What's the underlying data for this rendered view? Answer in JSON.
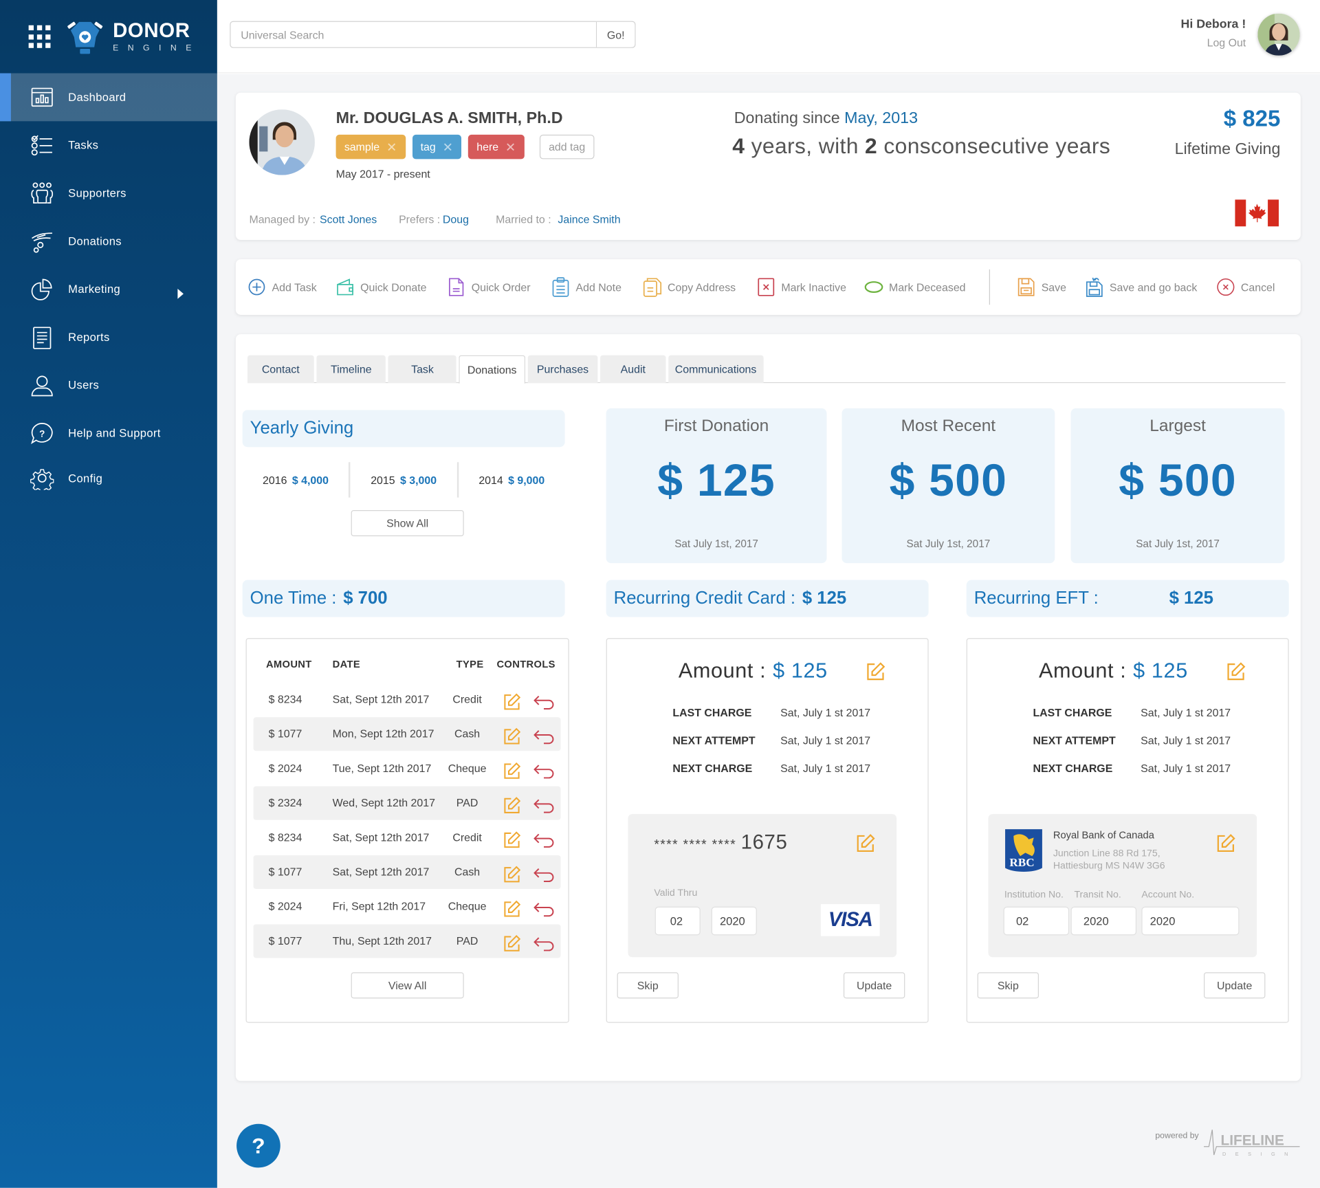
{
  "app": {
    "brand_name": "DONOR",
    "brand_sub": "ENGINE"
  },
  "colors": {
    "accent": "#1a74b8",
    "sidebar_top": "#063a64",
    "tag_sample": "#e8ae4b",
    "tag_tag": "#4f9fd0",
    "tag_here": "#d65a5a",
    "edit_icon": "#f0a830",
    "undo_icon": "#c8424f"
  },
  "sidebar": {
    "items": [
      {
        "label": "Dashboard",
        "icon": "dashboard-icon",
        "active": true
      },
      {
        "label": "Tasks",
        "icon": "tasks-icon"
      },
      {
        "label": "Supporters",
        "icon": "supporters-icon"
      },
      {
        "label": "Donations",
        "icon": "donations-icon"
      },
      {
        "label": "Marketing",
        "icon": "pie-chart-icon",
        "has_submenu": true
      },
      {
        "label": "Reports",
        "icon": "reports-icon"
      },
      {
        "label": "Users",
        "icon": "user-icon"
      },
      {
        "label": "Help and Support",
        "icon": "help-icon"
      },
      {
        "label": "Config",
        "icon": "gear-icon"
      }
    ]
  },
  "topbar": {
    "search_placeholder": "Universal Search",
    "search_value": "",
    "go_label": "Go!",
    "greeting": "Hi Debora !",
    "logout_label": "Log Out"
  },
  "profile": {
    "name": "Mr. DOUGLAS A. SMITH, Ph.D",
    "tags": [
      "sample",
      "tag",
      "here"
    ],
    "add_tag_label": "add tag",
    "period": "May 2017 - present",
    "managed_by_label": "Managed by :",
    "managed_by": "Scott Jones",
    "prefers_label": "Prefers :",
    "prefers": "Doug",
    "married_label": "Married to :",
    "married_to": "Jaince Smith",
    "donating_since_label": "Donating since",
    "donating_since": "May, 2013",
    "years_total": "4",
    "years_text_1": "years, with",
    "years_consecutive": "2",
    "years_text_2": "consconsecutive years",
    "lifetime_amount": "$ 825",
    "lifetime_label": "Lifetime Giving",
    "country_flag": "canada-flag"
  },
  "actions": {
    "add_task": "Add Task",
    "quick_donate": "Quick Donate",
    "quick_order": "Quick Order",
    "add_note": "Add Note",
    "copy_address": "Copy Address",
    "mark_inactive": "Mark Inactive",
    "mark_deceased": "Mark Deceased",
    "save": "Save",
    "save_back": "Save and go back",
    "cancel": "Cancel"
  },
  "tabs": [
    {
      "label": "Contact"
    },
    {
      "label": "Timeline"
    },
    {
      "label": "Task"
    },
    {
      "label": "Donations",
      "active": true
    },
    {
      "label": "Purchases"
    },
    {
      "label": "Audit"
    },
    {
      "label": "Communications"
    }
  ],
  "yearly": {
    "title": "Yearly Giving",
    "years": [
      {
        "year": "2016",
        "amount": "$ 4,000"
      },
      {
        "year": "2015",
        "amount": "$ 3,000"
      },
      {
        "year": "2014",
        "amount": "$ 9,000"
      }
    ],
    "show_all_label": "Show All"
  },
  "stats": [
    {
      "title": "First Donation",
      "amount": "$ 125",
      "date": "Sat July 1st, 2017"
    },
    {
      "title": "Most Recent",
      "amount": "$ 500",
      "date": "Sat July 1st, 2017"
    },
    {
      "title": "Largest",
      "amount": "$ 500",
      "date": "Sat July 1st, 2017"
    }
  ],
  "one_time": {
    "label": "One Time :",
    "amount": "$ 700",
    "columns": [
      "AMOUNT",
      "DATE",
      "TYPE",
      "CONTROLS"
    ],
    "rows": [
      {
        "amount": "$ 8234",
        "date": "Sat, Sept 12th 2017",
        "type": "Credit"
      },
      {
        "amount": "$ 1077",
        "date": "Mon, Sept 12th 2017",
        "type": "Cash"
      },
      {
        "amount": "$ 2024",
        "date": "Tue, Sept 12th 2017",
        "type": "Cheque"
      },
      {
        "amount": "$ 2324",
        "date": "Wed, Sept 12th 2017",
        "type": "PAD"
      },
      {
        "amount": "$ 8234",
        "date": "Sat, Sept 12th 2017",
        "type": "Credit"
      },
      {
        "amount": "$ 1077",
        "date": "Sat, Sept 12th 2017",
        "type": "Cash"
      },
      {
        "amount": "$ 2024",
        "date": "Fri, Sept 12th 2017",
        "type": "Cheque"
      },
      {
        "amount": "$ 1077",
        "date": "Thu, Sept 12th 2017",
        "type": "PAD"
      }
    ],
    "view_all_label": "View All"
  },
  "recurring_cc": {
    "label": "Recurring Credit Card :",
    "amount": "$ 125",
    "amount_label": "Amount :",
    "amount_value": "$ 125",
    "last_charge_label": "LAST CHARGE",
    "last_charge": "Sat, July 1 st 2017",
    "next_attempt_label": "NEXT ATTEMPT",
    "next_attempt": "Sat, July 1 st 2017",
    "next_charge_label": "NEXT CHARGE",
    "next_charge": "Sat, July 1 st 2017",
    "card_mask": "**** **** ****",
    "card_last4": "1675",
    "valid_thru_label": "Valid Thru",
    "exp_month": "02",
    "exp_year": "2020",
    "card_brand": "VISA",
    "skip_label": "Skip",
    "update_label": "Update"
  },
  "recurring_eft": {
    "label": "Recurring EFT :",
    "amount": "$ 125",
    "amount_label": "Amount :",
    "amount_value": "$ 125",
    "last_charge_label": "LAST CHARGE",
    "last_charge": "Sat, July 1 st 2017",
    "next_attempt_label": "NEXT ATTEMPT",
    "next_attempt": "Sat, July 1 st 2017",
    "next_charge_label": "NEXT CHARGE",
    "next_charge": "Sat, July 1 st 2017",
    "bank_logo": "RBC",
    "bank_name": "Royal Bank of Canada",
    "bank_address_1": "Junction Line 88 Rd 175,",
    "bank_address_2": "Hattiesburg MS N4W 3G6",
    "institution_label": "Institution No.",
    "transit_label": "Transit No.",
    "account_label": "Account No.",
    "institution_no": "02",
    "transit_no": "2020",
    "account_no": "2020",
    "skip_label": "Skip",
    "update_label": "Update"
  },
  "footer": {
    "help_label": "?",
    "powered_by": "powered by",
    "company": "LIFELINE",
    "company_sub": "DESIGN"
  }
}
